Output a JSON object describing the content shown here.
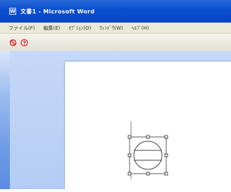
{
  "window": {
    "title": "文書1 - Microsoft Word",
    "app_icon_glyph": "W"
  },
  "menu": {
    "items": [
      "ファイル(F)",
      "編集(E)",
      "ｵﾌﾟｼｮﾝ(O)",
      "ｳｨﾝﾄﾞｳ(W)",
      "ﾍﾙﾌﾟ(H)"
    ]
  },
  "toolbar": {
    "buttons": [
      {
        "name": "draw-shape-icon",
        "color": "#d42020"
      },
      {
        "name": "help-icon",
        "color": "#d42020"
      }
    ]
  },
  "colors": {
    "titlebar": "#0a4fd0",
    "menubar": "#ece9d8",
    "workspace_bg": "#b4cdf4",
    "page": "#ffffff",
    "icon_red": "#d42020"
  }
}
